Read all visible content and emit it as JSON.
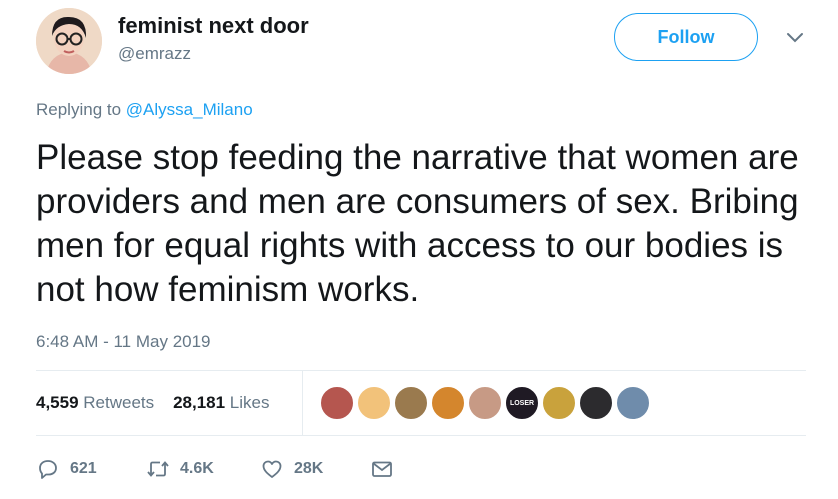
{
  "tweet": {
    "display_name": "feminist next door",
    "handle": "@emrazz",
    "follow_label": "Follow",
    "replying_prefix": "Replying to ",
    "replying_to": "@Alyssa_Milano",
    "text": "Please stop feeding the narrative that women are providers and men are consumers of sex. Bribing men for equal rights with access to our bodies is not how feminism works.",
    "timestamp": "6:48 AM - 11 May 2019"
  },
  "stats": {
    "retweets_count": "4,559",
    "retweets_label": "Retweets",
    "likes_count": "28,181",
    "likes_label": "Likes"
  },
  "liker_avatars": [
    {
      "color": "#b5564f"
    },
    {
      "color": "#f2c27a"
    },
    {
      "color": "#9a7a4e"
    },
    {
      "color": "#d4862d"
    },
    {
      "color": "#c79a85"
    },
    {
      "color": "#1f1a24",
      "text": "LOSER"
    },
    {
      "color": "#c9a23c"
    },
    {
      "color": "#2c2b2e"
    },
    {
      "color": "#6f8cab"
    }
  ],
  "actions": {
    "reply_count": "621",
    "retweet_count": "4.6K",
    "like_count": "28K"
  },
  "colors": {
    "accent": "#1da1f2",
    "secondary_text": "#657786",
    "primary_text": "#14171a",
    "divider": "#e6ecf0"
  },
  "icons": [
    "chevron-down-icon",
    "reply-icon",
    "retweet-icon",
    "heart-icon",
    "mail-icon"
  ]
}
